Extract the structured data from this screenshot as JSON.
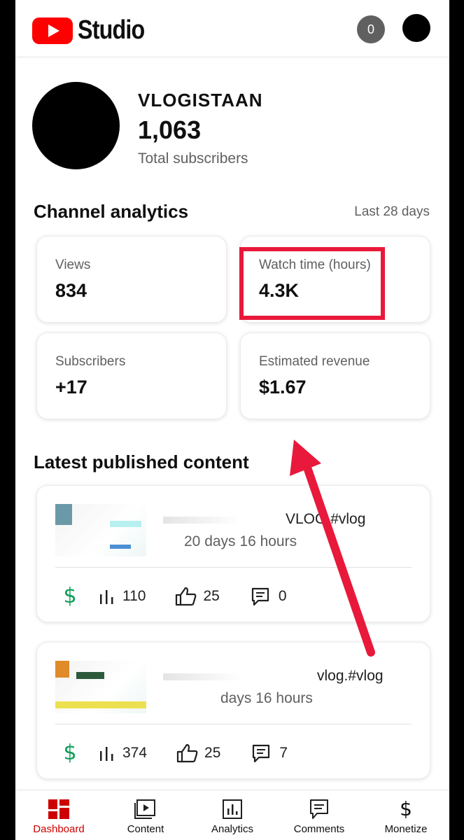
{
  "header": {
    "app_title": "Studio",
    "notification_count": "0"
  },
  "channel": {
    "name": "VLOGISTAAN",
    "subscriber_count": "1,063",
    "subscriber_label": "Total subscribers"
  },
  "analytics": {
    "title": "Channel analytics",
    "period": "Last 28 days",
    "metrics": [
      {
        "label": "Views",
        "value": "834"
      },
      {
        "label": "Watch time (hours)",
        "value": "4.3K"
      },
      {
        "label": "Subscribers",
        "value": "+17"
      },
      {
        "label": "Estimated revenue",
        "value": "$1.67"
      }
    ]
  },
  "latest": {
    "title": "Latest published content",
    "videos": [
      {
        "title_visible": "VLOG #vlog",
        "age": "20 days 16 hours",
        "monetization": "$",
        "views": "110",
        "likes": "25",
        "comments": "0"
      },
      {
        "title_visible": "vlog.#vlog",
        "age": "days 16 hours",
        "monetization": "$",
        "views": "374",
        "likes": "25",
        "comments": "7"
      }
    ]
  },
  "nav": {
    "items": [
      {
        "label": "Dashboard",
        "icon": "dashboard-icon"
      },
      {
        "label": "Content",
        "icon": "content-icon"
      },
      {
        "label": "Analytics",
        "icon": "analytics-icon"
      },
      {
        "label": "Comments",
        "icon": "comments-icon"
      },
      {
        "label": "Monetize",
        "icon": "monetize-icon"
      }
    ],
    "active": "Dashboard"
  },
  "colors": {
    "brand_red": "#ff0000",
    "highlight": "#e8193b",
    "money_green": "#0f9d58"
  }
}
